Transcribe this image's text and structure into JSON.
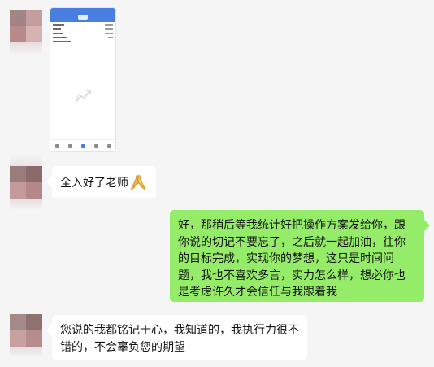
{
  "messages": {
    "m1": {
      "type": "image",
      "image_alt": "phone screenshot"
    },
    "m2": {
      "type": "text",
      "text": "全入好了老师",
      "emoji": "folded-hands"
    },
    "m3": {
      "type": "text",
      "text": "好，那稍后等我统计好把操作方案发给你，跟你说的切记不要忘了，之后就一起加油，往你的目标完成，实现你的梦想，这只是时间问题，我也不喜欢多言，实力怎么样，想必你也是考虑许久才会信任与我跟着我"
    },
    "m4": {
      "type": "text",
      "text": "您说的我都铭记于心，我知道的，我执行力很不错的，不会辜负您的期望"
    }
  },
  "colors": {
    "background": "#f5f5f5",
    "incoming_bubble": "#ffffff",
    "outgoing_bubble": "#95ec69",
    "phone_header": "#4a7de0",
    "avatar_tiles": [
      "#9b7c7d",
      "#b88d8b",
      "#c9999b",
      "#d9b3b4"
    ]
  },
  "icons": {
    "hands": "folded-hands-icon",
    "avatar": "avatar-icon"
  }
}
